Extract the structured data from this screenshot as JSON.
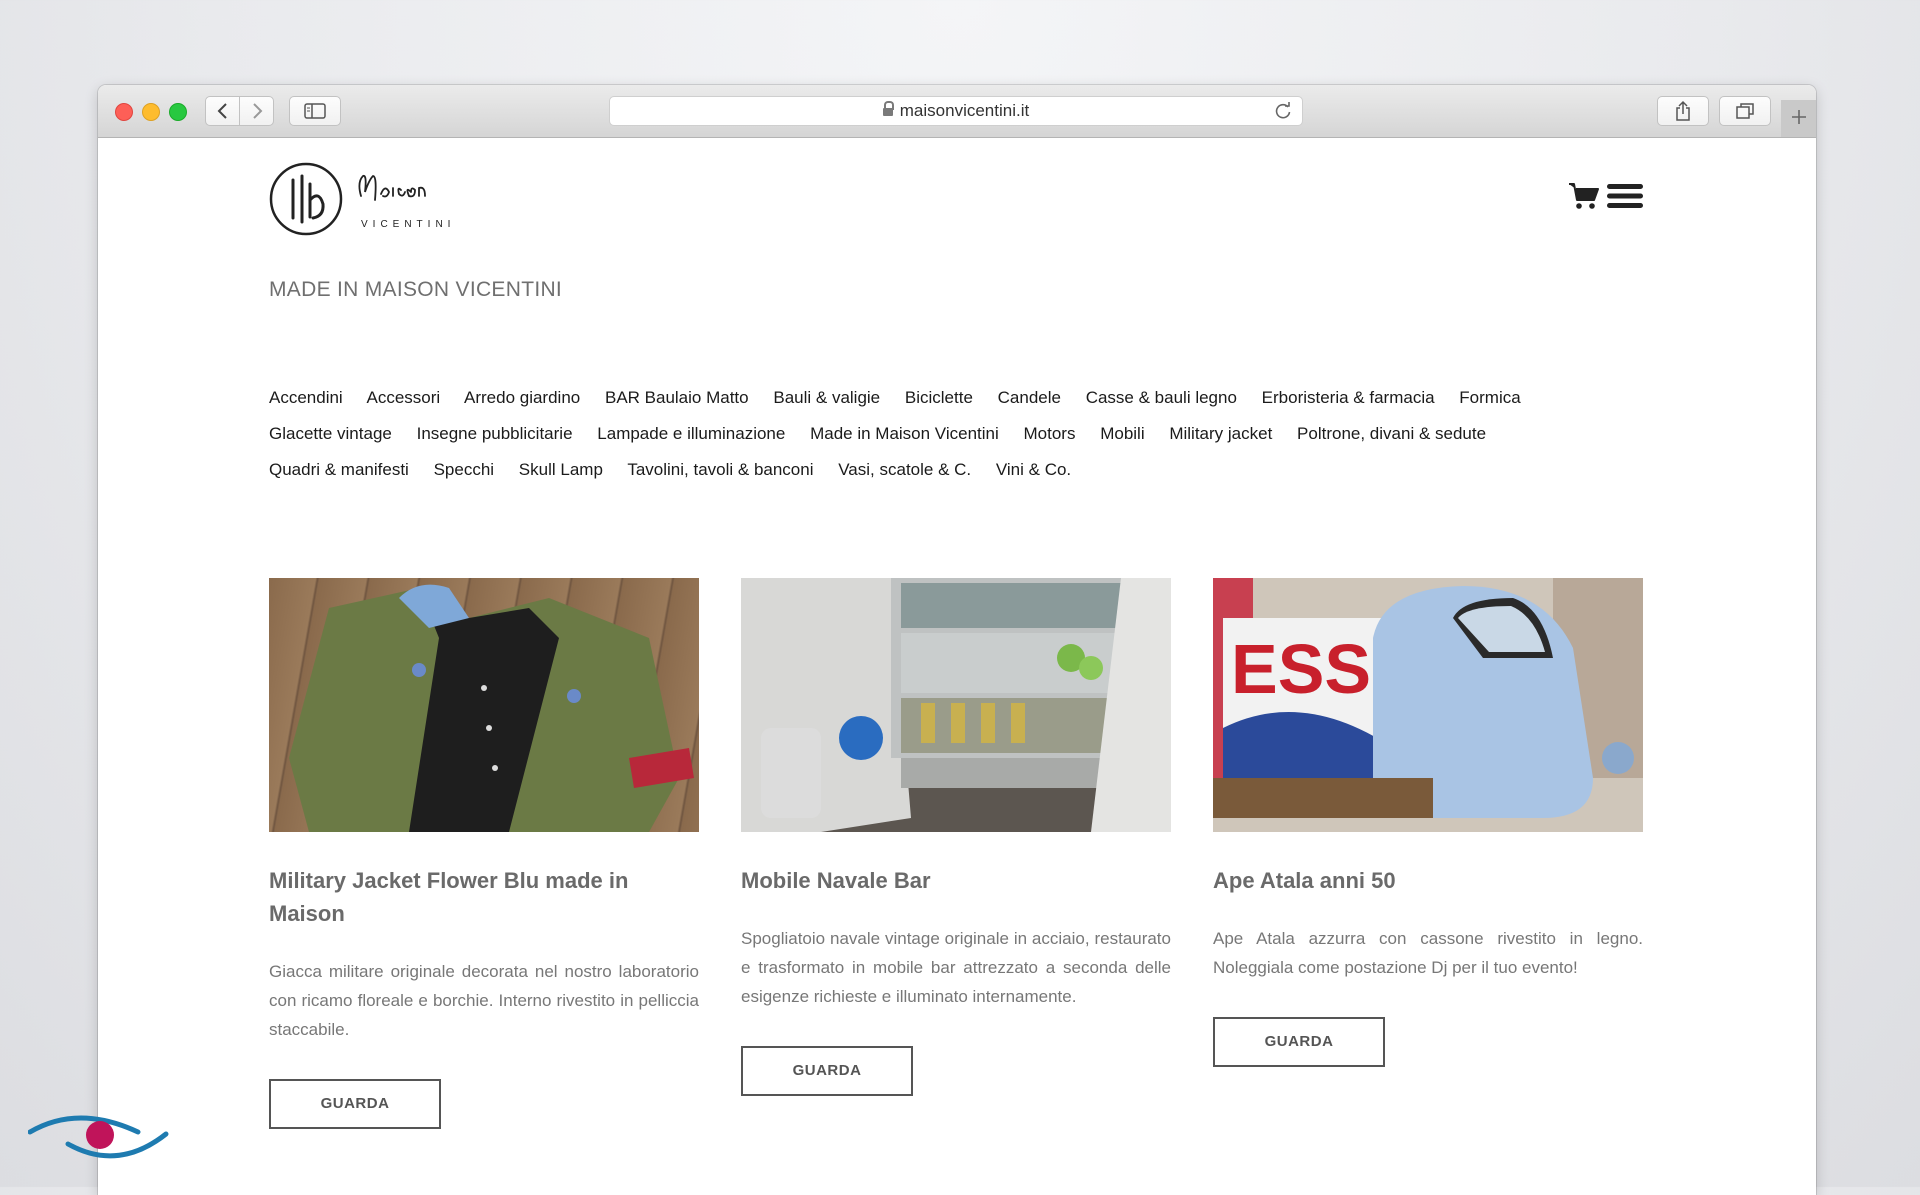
{
  "browser": {
    "url": "maisonvicentini.it"
  },
  "site": {
    "logo_text": "Maison",
    "logo_subtext": "VICENTINI",
    "page_title": "MADE IN MAISON VICENTINI"
  },
  "categories": [
    "Accendini",
    "Accessori",
    "Arredo giardino",
    "BAR Baulaio Matto",
    "Bauli & valigie",
    "Biciclette",
    "Candele",
    "Casse & bauli legno",
    "Erboristeria & farmacia",
    "Formica",
    "Glacette vintage",
    "Insegne pubblicitarie",
    "Lampade e illuminazione",
    "Made in Maison Vicentini",
    "Motors",
    "Mobili",
    "Military jacket",
    "Poltrone, divani & sedute",
    "Quadri & manifesti",
    "Specchi",
    "Skull Lamp",
    "Tavolini, tavoli & banconi",
    "Vasi, scatole & C.",
    "Vini & Co."
  ],
  "products": [
    {
      "title": "Military Jacket Flower Blu made in Maison",
      "description": "Giacca militare originale decorata nel nostro laboratorio con ricamo floreale e borchie. Interno rivestito in pelliccia staccabile.",
      "button": "GUARDA"
    },
    {
      "title": "Mobile Navale Bar",
      "description": "Spogliatoio navale vintage originale in acciaio, restaurato e trasformato in mobile bar attrezzato a seconda delle esigenze richieste e illuminato internamente.",
      "button": "GUARDA"
    },
    {
      "title": "Ape Atala anni 50",
      "description": "Ape Atala azzurra con cassone rivestito in legno. Noleggiala come postazione Dj per il tuo evento!",
      "button": "GUARDA",
      "image_sign_text": "ESSO"
    }
  ],
  "icons": {
    "cart": "cart-icon",
    "menu": "hamburger-menu-icon"
  }
}
